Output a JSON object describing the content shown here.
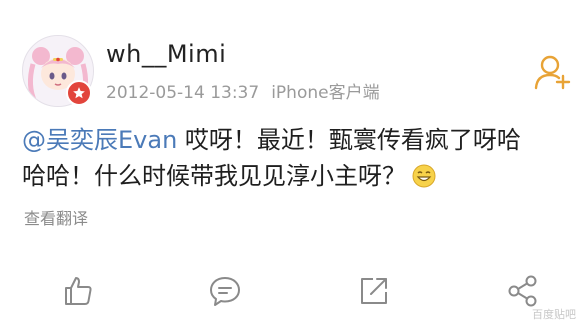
{
  "post": {
    "username": "wh__Mimi",
    "timestamp": "2012-05-14 13:37",
    "source": "iPhone客户端",
    "avatar_icon": "sailor-moon-avatar",
    "verified_icon": "star-badge-icon",
    "follow_icon": "add-user-icon",
    "content": {
      "mention": "@吴奕辰Evan",
      "text_line1": " 哎呀！最近！甄寰传看疯了呀哈",
      "text_line2": "哈哈！什么时候带我见见淳小主呀？",
      "emoji_icon": "grin-emoji-icon"
    },
    "translate_label": "查看翻译"
  },
  "actions": [
    {
      "name": "like",
      "icon": "thumbs-up-icon"
    },
    {
      "name": "comment",
      "icon": "comment-icon"
    },
    {
      "name": "repost",
      "icon": "share-out-icon"
    },
    {
      "name": "share",
      "icon": "share-nodes-icon"
    }
  ],
  "colors": {
    "mention": "#4b7ab8",
    "meta_text": "#9a9a9a",
    "icon_stroke": "#8a8a8a",
    "badge": "#e2453c",
    "follow": "#e8a336"
  },
  "watermark": "百度贴吧"
}
